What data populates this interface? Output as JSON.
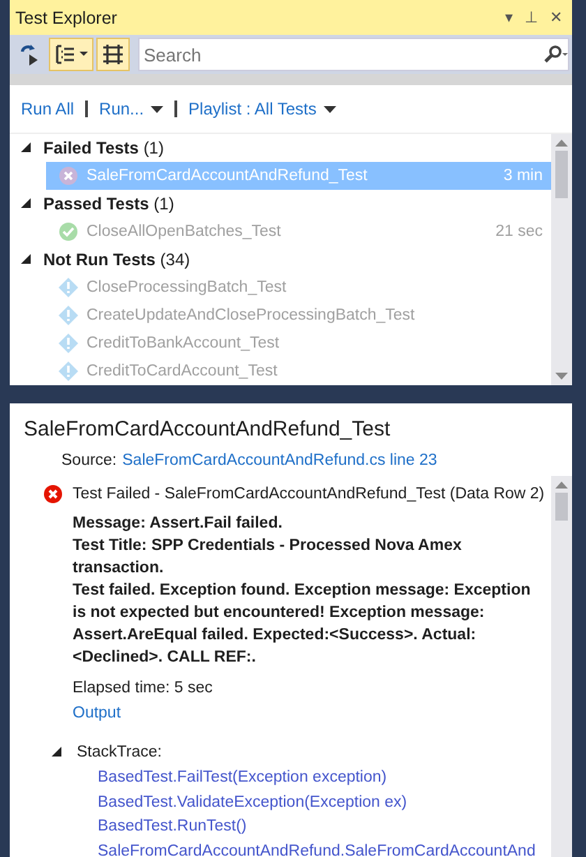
{
  "window": {
    "title": "Test Explorer",
    "controls": [
      "▾",
      "⊥",
      "✕"
    ]
  },
  "toolbar": {
    "search": {
      "placeholder": "Search"
    },
    "group_by_selected": true
  },
  "commands": [
    {
      "label": "Run All",
      "dropdown": false
    },
    {
      "label": "Run...",
      "dropdown": true
    },
    {
      "label": "Playlist : All Tests",
      "dropdown": true
    }
  ],
  "groups": [
    {
      "title": "Failed Tests",
      "count": "(1)",
      "expanded": true,
      "tests": [
        {
          "name": "SaleFromCardAccountAndRefund_Test",
          "kind": "failed",
          "duration": "3 min",
          "selected": true
        }
      ]
    },
    {
      "title": "Passed Tests",
      "count": "(1)",
      "expanded": true,
      "tests": [
        {
          "name": "CloseAllOpenBatches_Test",
          "kind": "passed",
          "duration": "21 sec",
          "selected": false
        }
      ]
    },
    {
      "title": "Not Run Tests",
      "count": "(34)",
      "expanded": true,
      "tests": [
        {
          "name": "CloseProcessingBatch_Test",
          "kind": "notrun",
          "selected": false
        },
        {
          "name": "CreateUpdateAndCloseProcessingBatch_Test",
          "kind": "notrun",
          "selected": false
        },
        {
          "name": "CreditToBankAccount_Test",
          "kind": "notrun",
          "selected": false
        },
        {
          "name": "CreditToCardAccount_Test",
          "kind": "notrun",
          "selected": false
        }
      ]
    }
  ],
  "details": {
    "title": "SaleFromCardAccountAndRefund_Test",
    "source_label": "Source:",
    "source_link": "SaleFromCardAccountAndRefund.cs line 23",
    "result": "Test Failed - SaleFromCardAccountAndRefund_Test (Data Row 2)",
    "kind": "failed",
    "message": [
      "Message: Assert.Fail failed.",
      "Test Title: SPP Credentials - Processed Nova Amex transaction.",
      "Test failed. Exception found. Exception message: Exception is not expected but encountered! Exception message: Assert.AreEqual failed. Expected:<Success>. Actual:<Declined>. CALL REF:."
    ],
    "elapsed": "Elapsed time: 5 sec",
    "output_link": "Output",
    "stack_trace": {
      "label": "StackTrace:",
      "expanded": true,
      "frames": [
        "BasedTest.FailTest(Exception exception)",
        "BasedTest.ValidateException(Exception ex)",
        "BasedTest.RunTest()",
        "SaleFromCardAccountAndRefund.SaleFromCardAccountAnd"
      ]
    }
  }
}
